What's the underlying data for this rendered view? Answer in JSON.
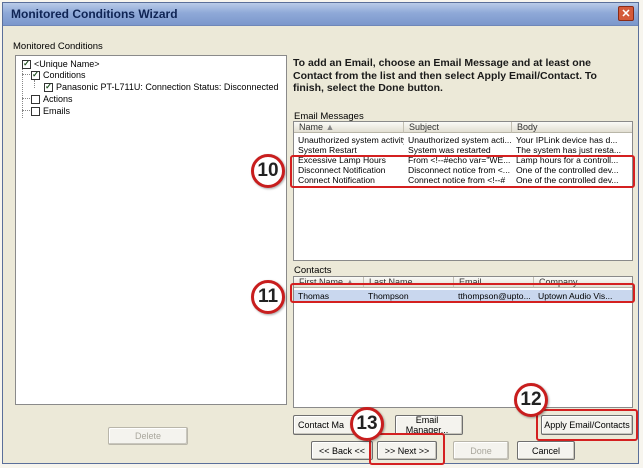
{
  "window": {
    "title": "Monitored Conditions Wizard",
    "close_glyph": "✕"
  },
  "tree": {
    "group_label": "Monitored Conditions",
    "nodes": {
      "root": "<Unique Name>",
      "conditions": "Conditions",
      "condition_item": "Panasonic PT-L711U: Connection Status: Disconnected",
      "actions": "Actions",
      "emails": "Emails"
    },
    "delete_label": "Delete"
  },
  "instructions": "To add an Email, choose an Email Message and at least one Contact from the list and then select Apply Email/Contact. To finish, select the Done button.",
  "email_messages": {
    "label": "Email Messages",
    "columns": [
      "Name",
      "Subject",
      "Body"
    ],
    "rows": [
      [
        "Unauthorized system activity",
        "Unauthorized system acti...",
        "Your IPLink device has d..."
      ],
      [
        "System Restart",
        "System was restarted",
        "The system has just resta..."
      ],
      [
        "Excessive Lamp Hours",
        "From <!--#echo var=\"WE...",
        "Lamp hours for a controll..."
      ],
      [
        "Disconnect Notification",
        "Disconnect notice from <...",
        "One of the controlled dev..."
      ],
      [
        "Connect Notification",
        "Connect notice from <!--#",
        "One of the controlled dev..."
      ]
    ]
  },
  "contacts": {
    "label": "Contacts",
    "columns": [
      "First Name",
      "Last Name",
      "Email",
      "Company"
    ],
    "rows": [
      [
        "Thomas",
        "Thompson",
        "tthompson@upto...",
        "Uptown Audio Vis..."
      ]
    ]
  },
  "buttons": {
    "contact_manager": "Contact Ma",
    "email_manager": "Email Manager...",
    "apply": "Apply Email/Contacts",
    "back": "<< Back <<",
    "next": ">> Next >>",
    "done": "Done",
    "cancel": "Cancel"
  },
  "callouts": {
    "c10": "10",
    "c11": "11",
    "c12": "12",
    "c13": "13"
  },
  "colors": {
    "callout_border": "#c81e1e",
    "highlight_box": "#d42020",
    "titlebar": "#8fa9d8"
  }
}
